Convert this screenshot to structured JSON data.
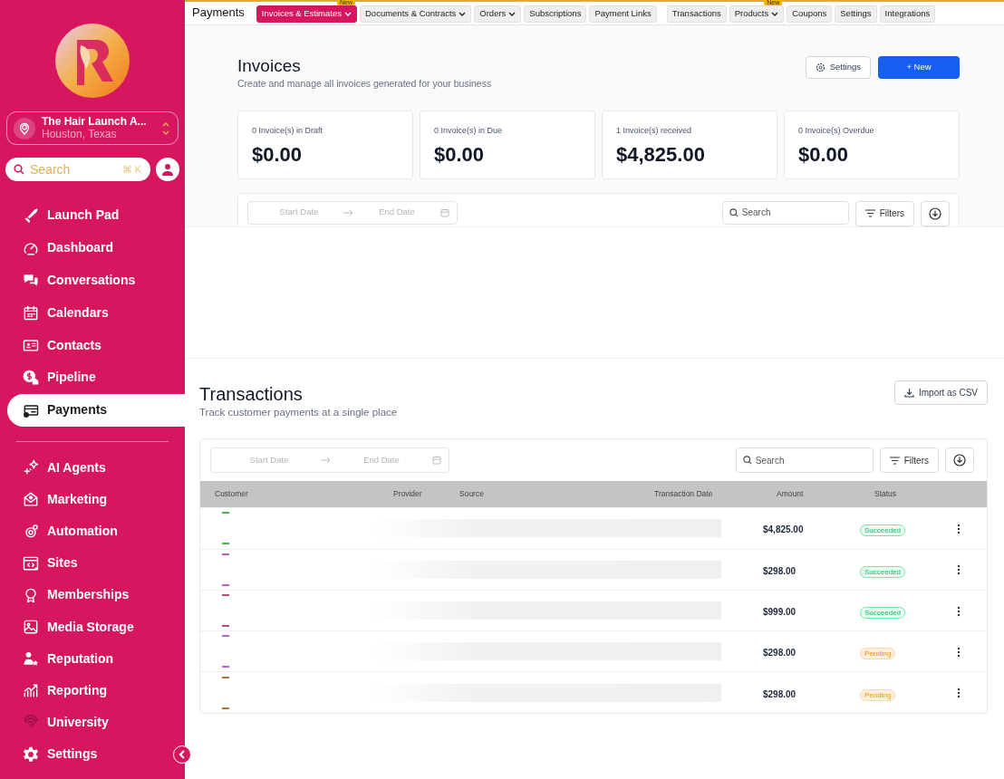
{
  "sidebar": {
    "location": {
      "name": "The Hair Launch A...",
      "city": "Houston, Texas"
    },
    "search": {
      "placeholder": "Search",
      "shortcut": "⌘ K"
    },
    "groups": [
      [
        {
          "label": "Launch Pad",
          "selected": false
        },
        {
          "label": "Dashboard",
          "selected": false
        },
        {
          "label": "Conversations",
          "selected": false
        },
        {
          "label": "Calendars",
          "selected": false
        },
        {
          "label": "Contacts",
          "selected": false
        },
        {
          "label": "Pipeline",
          "selected": false
        },
        {
          "label": "Payments",
          "selected": true
        }
      ],
      [
        {
          "label": "AI Agents",
          "selected": false
        },
        {
          "label": "Marketing",
          "selected": false
        },
        {
          "label": "Automation",
          "selected": false
        },
        {
          "label": "Sites",
          "selected": false
        },
        {
          "label": "Memberships",
          "selected": false
        },
        {
          "label": "Media Storage",
          "selected": false
        },
        {
          "label": "Reputation",
          "selected": false
        },
        {
          "label": "Reporting",
          "selected": false
        },
        {
          "label": "University",
          "selected": false
        },
        {
          "label": "Settings",
          "selected": false
        }
      ]
    ]
  },
  "topbar": {
    "title": "Payments",
    "tabs": [
      {
        "label": "Invoices & Estimates",
        "selected": true,
        "has_menu": true,
        "badge": "New"
      },
      {
        "label": "Documents & Contracts",
        "selected": false,
        "has_menu": true
      },
      {
        "label": "Orders",
        "selected": false,
        "has_menu": true
      },
      {
        "label": "Subscriptions",
        "selected": false,
        "has_menu": false
      },
      {
        "label": "Payment Links",
        "selected": false,
        "has_menu": false
      },
      {
        "label": "Transactions",
        "selected": false,
        "has_menu": false
      },
      {
        "label": "Products",
        "selected": false,
        "has_menu": true,
        "badge": "New"
      },
      {
        "label": "Coupons",
        "selected": false,
        "has_menu": false
      },
      {
        "label": "Settings",
        "selected": false,
        "has_menu": false
      },
      {
        "label": "Integrations",
        "selected": false,
        "has_menu": false
      }
    ]
  },
  "invoices": {
    "title": "Invoices",
    "subtitle": "Create and manage all invoices generated for your business",
    "settings_button": "Settings",
    "new_button": "+ New",
    "cards": [
      {
        "label": "0 Invoice(s) in Draft",
        "amount": "$0.00"
      },
      {
        "label": "0 Invoice(s) in Due",
        "amount": "$0.00"
      },
      {
        "label": "1 Invoice(s) received",
        "amount": "$4,825.00"
      },
      {
        "label": "0 Invoice(s) Overdue",
        "amount": "$0.00"
      }
    ],
    "filters": {
      "start_placeholder": "Start Date",
      "end_placeholder": "End Date",
      "search_placeholder": "Search",
      "filters_button": "Filters"
    }
  },
  "transactions": {
    "title": "Transactions",
    "subtitle": "Track customer payments at a single place",
    "import_button": "Import as CSV",
    "filters": {
      "start_placeholder": "Start Date",
      "end_placeholder": "End Date",
      "search_placeholder": "Search",
      "filters_button": "Filters"
    },
    "columns": [
      "Customer",
      "Provider",
      "Source",
      "Transaction Date",
      "Amount",
      "Status"
    ],
    "rows": [
      {
        "color": "#4caf50",
        "amount": "$4,825.00",
        "status": {
          "text": "Succeeded",
          "kind": "success"
        }
      },
      {
        "color": "#c05fc0",
        "amount": "$298.00",
        "status": {
          "text": "Succeeded",
          "kind": "success"
        }
      },
      {
        "color": "#b0507a",
        "amount": "$999.00",
        "status": {
          "text": "Succeeded",
          "kind": "success"
        }
      },
      {
        "color": "#b565c9",
        "amount": "$298.00",
        "status": {
          "text": "Pending",
          "kind": "pending"
        }
      },
      {
        "color": "#a8743a",
        "amount": "$298.00",
        "status": {
          "text": "Pending",
          "kind": "pending"
        }
      }
    ]
  }
}
